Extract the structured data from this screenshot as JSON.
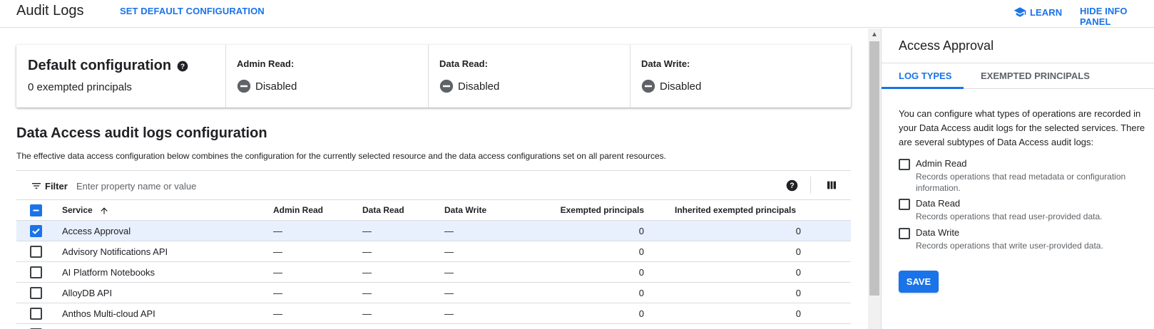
{
  "header": {
    "title": "Audit Logs",
    "set_default_label": "SET DEFAULT CONFIGURATION",
    "learn_label": "LEARN",
    "hide_panel_label": "HIDE INFO PANEL"
  },
  "default_config": {
    "title": "Default configuration",
    "exempted": "0 exempted principals",
    "columns": [
      {
        "label": "Admin Read:",
        "value": "Disabled"
      },
      {
        "label": "Data Read:",
        "value": "Disabled"
      },
      {
        "label": "Data Write:",
        "value": "Disabled"
      }
    ]
  },
  "section": {
    "title": "Data Access audit logs configuration",
    "description": "The effective data access configuration below combines the configuration for the currently selected resource and the data access configurations set on all parent resources."
  },
  "filter": {
    "label": "Filter",
    "placeholder": "Enter property name or value"
  },
  "table": {
    "headers": {
      "service": "Service",
      "admin_read": "Admin Read",
      "data_read": "Data Read",
      "data_write": "Data Write",
      "exempted": "Exempted principals",
      "inherited": "Inherited exempted principals"
    },
    "rows": [
      {
        "service": "Access Approval",
        "admin_read": "—",
        "data_read": "—",
        "data_write": "—",
        "exempted": "0",
        "inherited": "0",
        "selected": true
      },
      {
        "service": "Advisory Notifications API",
        "admin_read": "—",
        "data_read": "—",
        "data_write": "—",
        "exempted": "0",
        "inherited": "0",
        "selected": false
      },
      {
        "service": "AI Platform Notebooks",
        "admin_read": "—",
        "data_read": "—",
        "data_write": "—",
        "exempted": "0",
        "inherited": "0",
        "selected": false
      },
      {
        "service": "AlloyDB API",
        "admin_read": "—",
        "data_read": "—",
        "data_write": "—",
        "exempted": "0",
        "inherited": "0",
        "selected": false
      },
      {
        "service": "Anthos Multi-cloud API",
        "admin_read": "—",
        "data_read": "—",
        "data_write": "—",
        "exempted": "0",
        "inherited": "0",
        "selected": false
      }
    ]
  },
  "panel": {
    "title": "Access Approval",
    "tabs": [
      "LOG TYPES",
      "EXEMPTED PRINCIPALS"
    ],
    "description": "You can configure what types of operations are recorded in your Data Access audit logs for the selected services. There are several subtypes of Data Access audit logs:",
    "options": [
      {
        "label": "Admin Read",
        "desc": "Records operations that read metadata or configuration information."
      },
      {
        "label": "Data Read",
        "desc": "Records operations that read user-provided data."
      },
      {
        "label": "Data Write",
        "desc": "Records operations that write user-provided data."
      }
    ],
    "save_label": "SAVE"
  },
  "colors": {
    "accent": "#1a73e8",
    "selected_row": "#e8f0fe",
    "text": "#202124",
    "secondary_text": "#5f6368"
  },
  "icons": [
    "learn-cap-icon",
    "help-icon",
    "disabled-icon",
    "filter-icon",
    "column-display-icon",
    "sort-arrow-up-icon",
    "check-icon",
    "indeterminate-check-icon",
    "scroll-up-icon"
  ]
}
